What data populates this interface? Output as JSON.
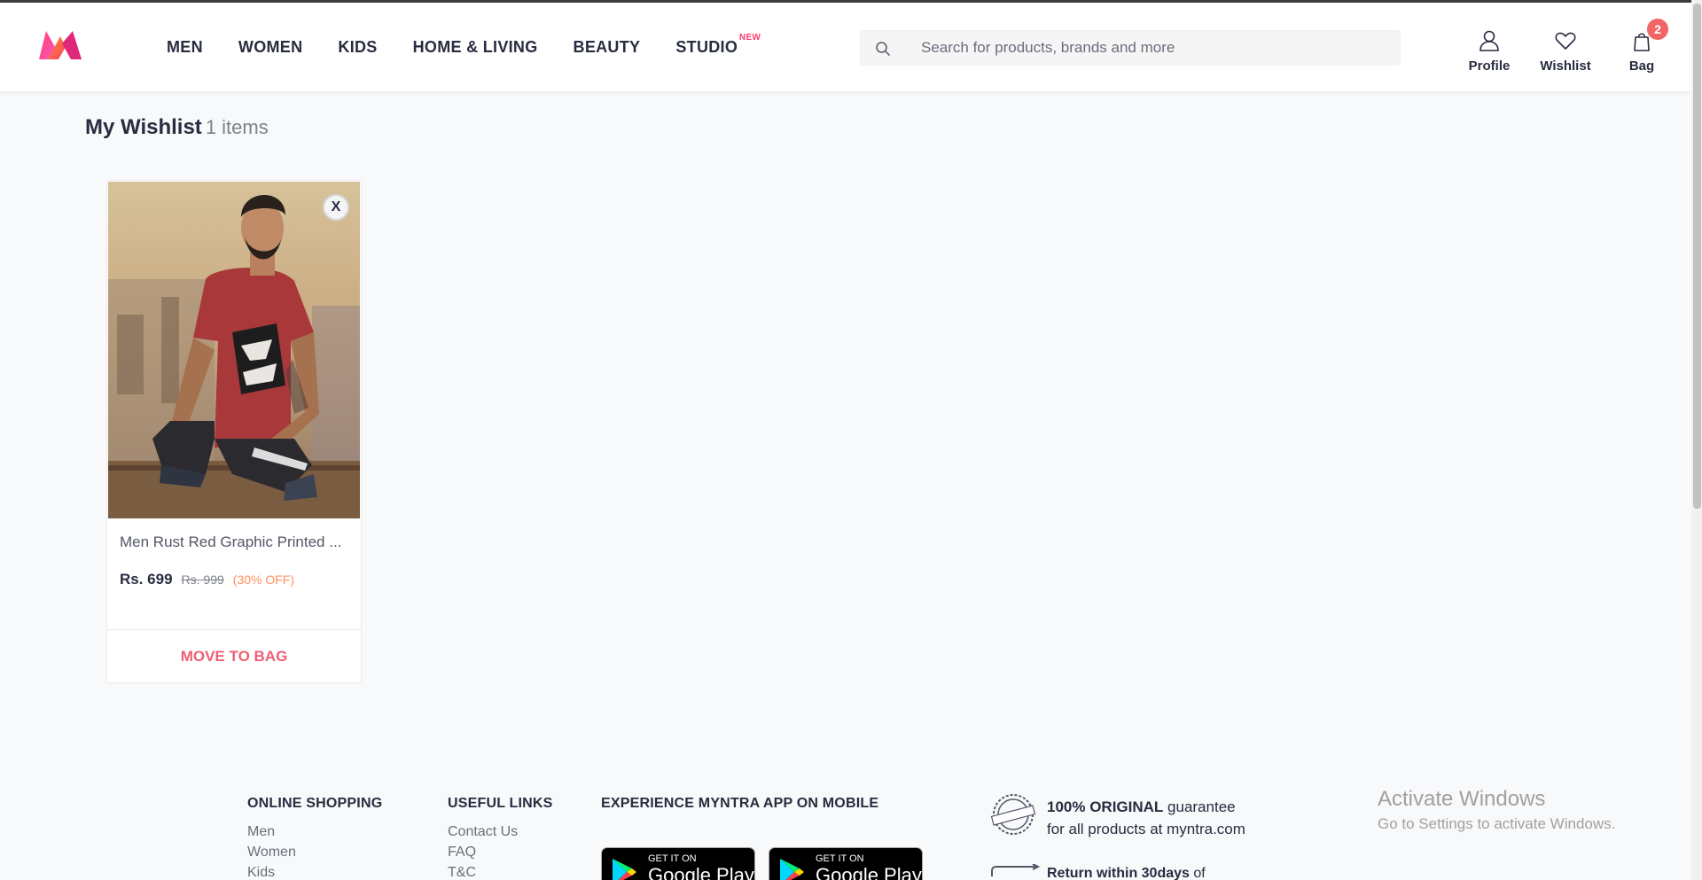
{
  "brand": {
    "logo_icon": "myntra-logo",
    "colors": {
      "accent": "#ff3f6c",
      "badge": "#f16565",
      "move_to_bag": "#ee5f73",
      "discount": "#ff905a"
    }
  },
  "nav": {
    "items": [
      {
        "label": "MEN"
      },
      {
        "label": "WOMEN"
      },
      {
        "label": "KIDS"
      },
      {
        "label": "HOME & LIVING"
      },
      {
        "label": "BEAUTY"
      },
      {
        "label": "STUDIO",
        "tag": "NEW"
      }
    ]
  },
  "search": {
    "placeholder": "Search for products, brands and more",
    "value": "",
    "icon": "search-icon"
  },
  "actions": {
    "profile": {
      "label": "Profile",
      "icon": "user-icon"
    },
    "wishlist": {
      "label": "Wishlist",
      "icon": "heart-icon"
    },
    "bag": {
      "label": "Bag",
      "icon": "bag-icon",
      "count": "2"
    }
  },
  "wishlist": {
    "title": "My Wishlist",
    "count_text": "1 items",
    "items": [
      {
        "name": "Men Rust Red Graphic Printed ...",
        "price": "Rs. 699",
        "mrp": "Rs. 999",
        "discount": "(30% OFF)",
        "close_label": "X",
        "action_label": "MOVE TO BAG"
      }
    ]
  },
  "footer": {
    "online_shopping": {
      "heading": "ONLINE SHOPPING",
      "links": [
        "Men",
        "Women",
        "Kids"
      ]
    },
    "useful_links": {
      "heading": "USEFUL LINKS",
      "links": [
        "Contact Us",
        "FAQ",
        "T&C"
      ]
    },
    "app": {
      "heading": "EXPERIENCE MYNTRA APP ON MOBILE",
      "badges": [
        {
          "small": "GET IT ON",
          "big": "Google Play"
        },
        {
          "small": "GET IT ON",
          "big": "Google Play"
        }
      ]
    },
    "promise": {
      "strong": "100% ORIGINAL",
      "rest": " guarantee",
      "line2": "for all products at myntra.com",
      "icon": "original-seal-icon"
    },
    "returns": {
      "strong": "Return within 30days",
      "rest": " of",
      "icon": "return-arrow-icon"
    }
  },
  "watermark": {
    "title": "Activate Windows",
    "subtitle": "Go to Settings to activate Windows."
  }
}
